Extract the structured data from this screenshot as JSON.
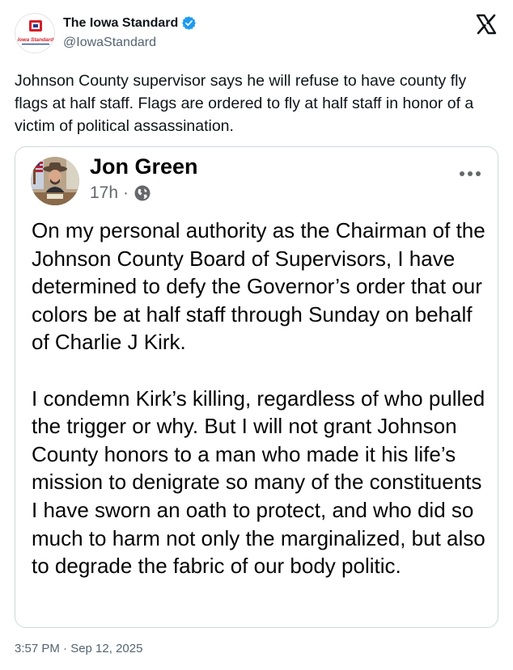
{
  "account": {
    "name": "The Iowa Standard",
    "handle": "@IowaStandard",
    "logo_text": "Iowa Standard",
    "verified": true
  },
  "tweet": {
    "text": "Johnson County supervisor says he will refuse to have county fly flags at half staff. Flags are ordered to fly at half staff in honor of a victim of political assassination."
  },
  "embedded_post": {
    "author": "Jon Green",
    "time": "17h",
    "separator": "·",
    "body": "On my personal authority as the Chairman of the Johnson County Board of Supervisors, I have determined to defy the Governor’s order that our colors be at half staff through Sunday on behalf of Charlie J Kirk.\n\nI condemn Kirk’s killing, regardless of who pulled the trigger or why. But I will not grant Johnson County honors to a man who made it his life’s mission to denigrate so many of the constituents I have sworn an oath to protect, and who did so much to harm not only the marginalized, but also to degrade the fabric of our body politic."
  },
  "footer": {
    "timestamp": "3:57 PM · Sep 12, 2025"
  },
  "icons": {
    "verified": "verified-badge-icon",
    "platform": "x-logo-icon",
    "audience": "globe-icon",
    "menu": "more-options-icon"
  },
  "colors": {
    "verified_blue": "#1d9bf0",
    "logo_red": "#d3202a",
    "logo_blue": "#1f3d8a",
    "secondary_text": "#536471"
  }
}
